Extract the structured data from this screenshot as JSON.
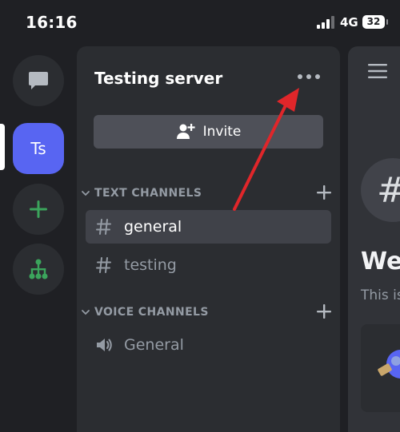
{
  "status_bar": {
    "time": "16:16",
    "network": "4G",
    "battery": "32"
  },
  "server_rail": {
    "dm_icon": "chat-bubble-icon",
    "active_server": "Ts",
    "add_icon": "plus-icon",
    "discover_icon": "hierarchy-icon"
  },
  "server": {
    "name": "Testing server",
    "more_icon": "ellipsis-icon",
    "invite_label": "Invite"
  },
  "categories": [
    {
      "label": "TEXT CHANNELS"
    },
    {
      "label": "VOICE CHANNELS"
    }
  ],
  "text_channels": [
    {
      "name": "general",
      "selected": true
    },
    {
      "name": "testing",
      "selected": false
    }
  ],
  "voice_channels": [
    {
      "name": "General"
    }
  ],
  "main": {
    "welcome_title": "Welcome to",
    "welcome_sub": "This is your brand new, shiny server."
  },
  "colors": {
    "background": "#1f2024",
    "panel": "#2b2d31",
    "main": "#313338",
    "brand": "#5865f2",
    "green": "#3ba55c",
    "selected": "#404249",
    "annotation": "#e0262a"
  }
}
